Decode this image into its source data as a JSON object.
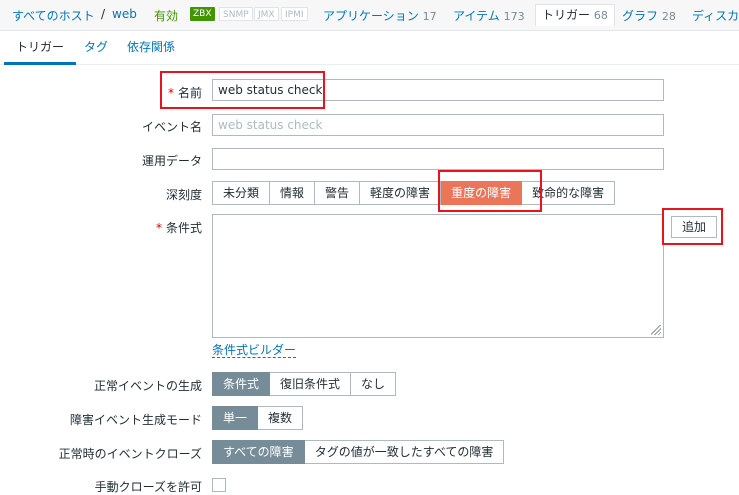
{
  "breadcrumb": {
    "all_hosts": "すべてのホスト",
    "separator": "/",
    "host": "web",
    "status": "有効",
    "badges": [
      "ZBX",
      "SNMP",
      "JMX",
      "IPMI"
    ]
  },
  "host_tabs": [
    {
      "label": "アプリケーション",
      "count": "17"
    },
    {
      "label": "アイテム",
      "count": "173"
    },
    {
      "label": "トリガー",
      "count": "68"
    },
    {
      "label": "グラフ",
      "count": "28"
    },
    {
      "label": "ディスカ",
      "count": ""
    }
  ],
  "form_tabs": [
    "トリガー",
    "タグ",
    "依存関係"
  ],
  "form": {
    "name": {
      "required_mark": "*",
      "label": "名前",
      "value": "web status check"
    },
    "event_name": {
      "label": "イベント名",
      "placeholder": "web status check"
    },
    "operational_data": {
      "label": "運用データ",
      "value": ""
    },
    "severity": {
      "label": "深刻度",
      "options": [
        "未分類",
        "情報",
        "警告",
        "軽度の障害",
        "重度の障害",
        "致命的な障害"
      ],
      "selected": "重度の障害"
    },
    "expression": {
      "required_mark": "*",
      "label": "条件式",
      "value": "",
      "add_button": "追加",
      "builder_link": "条件式ビルダー"
    },
    "ok_event_generation": {
      "label": "正常イベントの生成",
      "options": [
        "条件式",
        "復旧条件式",
        "なし"
      ],
      "selected": "条件式"
    },
    "problem_event_mode": {
      "label": "障害イベント生成モード",
      "options": [
        "単一",
        "複数"
      ],
      "selected": "単一"
    },
    "ok_event_closes": {
      "label": "正常時のイベントクローズ",
      "options": [
        "すべての障害",
        "タグの値が一致したすべての障害"
      ],
      "selected": "すべての障害"
    },
    "manual_close": {
      "label": "手動クローズを許可"
    }
  },
  "colors": {
    "accent": "#0275b8",
    "enabled": "#419600",
    "selected_segment": "#768d99",
    "severity_high": "#e97659",
    "highlight": "#e8141d"
  }
}
